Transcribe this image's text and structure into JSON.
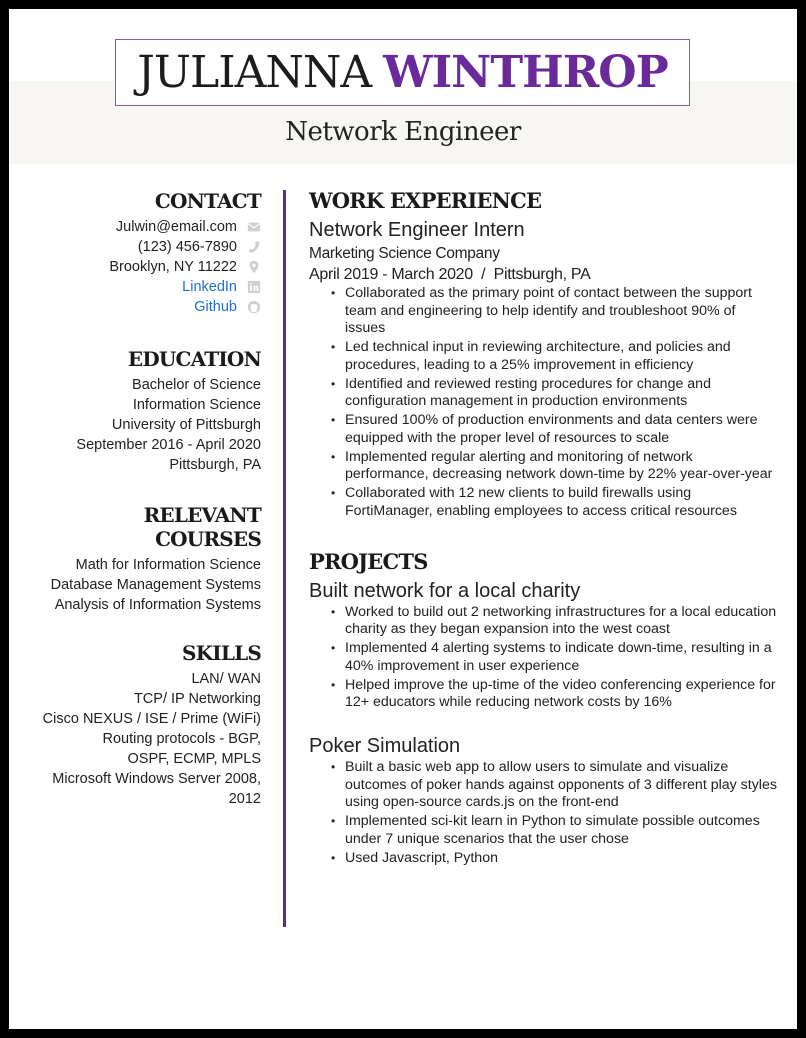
{
  "header": {
    "first_name": "JULIANNA",
    "last_name": "WINTHROP",
    "job_title": "Network Engineer"
  },
  "colors": {
    "accent": "#6a2a9a",
    "link": "#1f6fc8",
    "header_band": "#f7f6f3",
    "icon": "#c8c8c8"
  },
  "contact": {
    "title": "CONTACT",
    "items": [
      {
        "text": "Julwin@email.com",
        "icon": "envelope-icon",
        "link": false
      },
      {
        "text": "(123) 456-7890",
        "icon": "phone-icon",
        "link": false
      },
      {
        "text": "Brooklyn, NY 11222",
        "icon": "map-pin-icon",
        "link": false
      },
      {
        "text": "LinkedIn",
        "icon": "linkedin-icon",
        "link": true
      },
      {
        "text": "Github",
        "icon": "github-icon",
        "link": true
      }
    ]
  },
  "education": {
    "title": "EDUCATION",
    "degree": "Bachelor of Science",
    "major": "Information Science",
    "school": "University of Pittsburgh",
    "dates": "September 2016 - April 2020",
    "location": "Pittsburgh, PA"
  },
  "courses": {
    "title": "RELEVANT COURSES",
    "items": [
      "Math for Information Science",
      "Database Management Systems",
      "Analysis of Information Systems"
    ]
  },
  "skills": {
    "title": "SKILLS",
    "items": [
      "LAN/ WAN",
      "TCP/ IP Networking",
      "Cisco NEXUS / ISE / Prime (WiFi)",
      "Routing protocols - BGP, OSPF, ECMP, MPLS",
      "Microsoft Windows Server 2008, 2012"
    ]
  },
  "work": {
    "title": "WORK EXPERIENCE",
    "jobs": [
      {
        "role": "Network Engineer Intern",
        "company": "Marketing Science Company",
        "dates_location": "April 2019 - March 2020  /  Pittsburgh, PA",
        "bullets": [
          "Collaborated as the primary point of contact between the support team and engineering to help identify and troubleshoot 90% of issues",
          "Led technical input in reviewing architecture, and policies and procedures, leading to a 25% improvement in efficiency",
          "Identified and reviewed resting procedures for change and configuration management in production environments",
          "Ensured 100% of production environments and data centers were equipped with the proper level of resources to scale",
          "Implemented regular alerting and monitoring of network performance, decreasing network down-time by 22% year-over-year",
          "Collaborated with 12 new clients to build firewalls using FortiManager, enabling employees to access critical resources"
        ]
      }
    ]
  },
  "projects": {
    "title": "PROJECTS",
    "items": [
      {
        "name": "Built network for a local charity",
        "bullets": [
          "Worked to build out 2 networking infrastructures for a local education charity as they began expansion into the west coast",
          "Implemented 4 alerting systems to indicate down-time, resulting in a 40% improvement in user experience",
          "Helped improve the up-time of the video conferencing experience for 12+ educators while reducing network costs by 16%"
        ]
      },
      {
        "name": "Poker Simulation",
        "bullets": [
          "Built a basic web app to allow users to simulate and visualize outcomes of poker hands against opponents of 3 different play styles using open-source cards.js on the front-end",
          "Implemented sci-kit learn in Python to simulate possible outcomes under 7 unique scenarios that the user chose",
          "Used Javascript, Python"
        ]
      }
    ]
  }
}
